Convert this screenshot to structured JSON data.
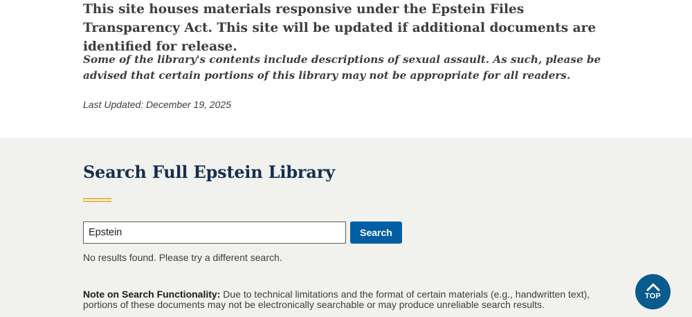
{
  "intro": {
    "description": "This site houses materials responsive under the Epstein Files Transparency Act. This site will be updated if additional documents are identified for release.",
    "warning": "Some of the library's contents include descriptions of sexual assault. As such, please be advised that certain portions of this library may not be appropriate for all readers.",
    "last_updated": "Last Updated: December 19, 2025"
  },
  "search": {
    "heading": "Search Full Epstein Library",
    "input_value": "Epstein",
    "button_label": "Search",
    "no_results": "No results found. Please try a different search.",
    "note_label": "Note on Search Functionality:",
    "note_text": " Due to technical limitations and the format of certain materials (e.g., handwritten text), portions of these documents may not be electronically searchable or may produce unreliable search results."
  },
  "top_button": {
    "label": "TOP",
    "icon": "chevron-up-icon"
  },
  "colors": {
    "heading": "#162e51",
    "accent_rule": "#e5b94a",
    "button": "#005ea2",
    "top_button": "#0a5b8d",
    "section_bg": "#f1f1ee"
  }
}
